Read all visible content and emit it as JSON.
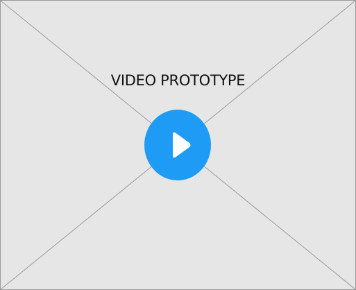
{
  "video": {
    "title": "VIDEO PROTOTYPE",
    "play_icon": "play-icon"
  },
  "colors": {
    "placeholder_background": "#e6e6e6",
    "placeholder_border": "#9a9a9a",
    "play_button": "#1e9bf5",
    "play_glyph": "#ffffff"
  }
}
